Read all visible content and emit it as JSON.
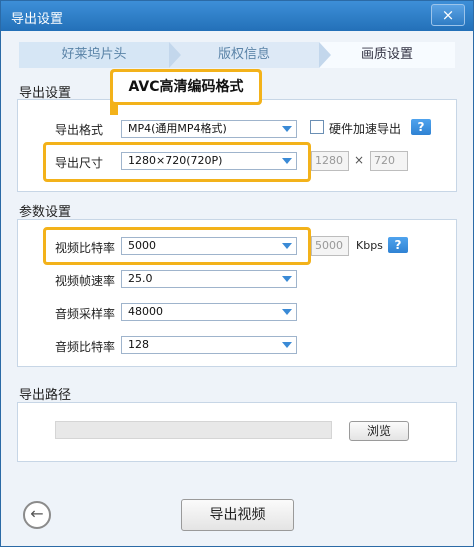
{
  "window": {
    "title": "导出设置",
    "close_icon": "×"
  },
  "tabs": [
    {
      "label": "好莱坞片头"
    },
    {
      "label": "版权信息"
    },
    {
      "label": "画质设置"
    }
  ],
  "callout": {
    "text": "AVC高清编码格式"
  },
  "export_settings": {
    "section_title": "导出设置",
    "format_label": "导出格式",
    "format_value": "MP4(通用MP4格式)",
    "hw_accel_label": "硬件加速导出",
    "hw_accel_checked": false,
    "size_label": "导出尺寸",
    "size_value": "1280×720(720P)",
    "width_value": "1280",
    "height_value": "720",
    "times": "×"
  },
  "params": {
    "section_title": "参数设置",
    "video_bitrate_label": "视频比特率",
    "video_bitrate_value": "5000",
    "video_bitrate_box": "5000",
    "kbps": "Kbps",
    "fps_label": "视频帧速率",
    "fps_value": "25.0",
    "sample_rate_label": "音频采样率",
    "sample_rate_value": "48000",
    "audio_bitrate_label": "音频比特率",
    "audio_bitrate_value": "128"
  },
  "help_text": "?",
  "path": {
    "section_title": "导出路径",
    "value": "",
    "browse_label": "浏览"
  },
  "footer": {
    "back_icon": "←",
    "export_label": "导出视频"
  },
  "colors": {
    "accent": "#2370b8",
    "highlight": "#f3b21a",
    "arrow": "#3a8ad6"
  }
}
